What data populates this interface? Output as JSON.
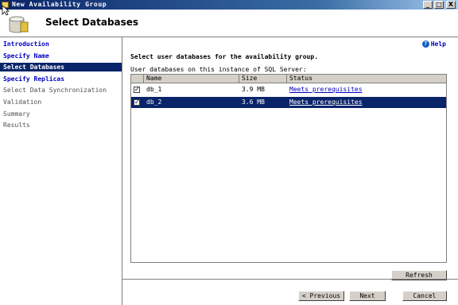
{
  "window": {
    "title": "New Availability Group",
    "controls": [
      "_",
      "□",
      "X"
    ]
  },
  "header": {
    "title": "Select Databases"
  },
  "nav": {
    "items": [
      {
        "label": "Introduction",
        "state": "link"
      },
      {
        "label": "Specify Name",
        "state": "link"
      },
      {
        "label": "Select Databases",
        "state": "selected"
      },
      {
        "label": "Specify Replicas",
        "state": "link"
      },
      {
        "label": "Select Data Synchronization",
        "state": "grey"
      },
      {
        "label": "Validation",
        "state": "grey"
      },
      {
        "label": "Summary",
        "state": "grey"
      },
      {
        "label": "Results",
        "state": "grey"
      }
    ]
  },
  "main": {
    "help_label": "Help",
    "instruction": "Select user databases for the availability group.",
    "sublabel": "User databases on this instance of SQL Server:",
    "columns": {
      "name": "Name",
      "size": "Size",
      "status": "Status"
    },
    "rows": [
      {
        "checked": true,
        "name": "db_1",
        "size": "3.9 MB",
        "status": "Meets prerequisites",
        "selected": false
      },
      {
        "checked": true,
        "name": "db_2",
        "size": "3.6 MB",
        "status": "Meets prerequisites",
        "selected": true
      }
    ],
    "refresh_label": "Refresh"
  },
  "footer": {
    "previous_label": "< Previous",
    "next_label": "Next",
    "cancel_label": "Cancel"
  },
  "colors": {
    "titlebar": "#0a246a",
    "selection": "#0a246a",
    "link": "#0000c0",
    "chrome": "#d4d0c8"
  }
}
